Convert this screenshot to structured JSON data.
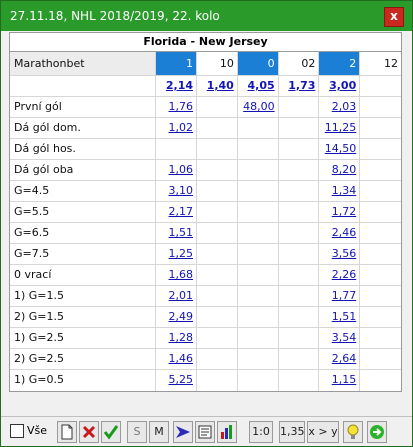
{
  "window": {
    "title": "27.11.18, NHL 2018/2019, 22. kolo",
    "close_label": "x"
  },
  "match": {
    "title": "Florida - New Jersey"
  },
  "table": {
    "bookmaker": "Marathonbet",
    "columns": [
      "1",
      "10",
      "0",
      "02",
      "2",
      "12"
    ],
    "main_odds": [
      "2,14",
      "1,40",
      "4,05",
      "1,73",
      "3,00",
      ""
    ],
    "rows": [
      {
        "label": "První gól",
        "values": [
          "1,76",
          "",
          "48,00",
          "",
          "2,03",
          ""
        ]
      },
      {
        "label": "Dá gól dom.",
        "values": [
          "1,02",
          "",
          "",
          "",
          "11,25",
          ""
        ]
      },
      {
        "label": "Dá gól hos.",
        "values": [
          "",
          "",
          "",
          "",
          "14,50",
          ""
        ]
      },
      {
        "label": "Dá gól oba",
        "values": [
          "1,06",
          "",
          "",
          "",
          "8,20",
          ""
        ]
      },
      {
        "label": "G=4.5",
        "values": [
          "3,10",
          "",
          "",
          "",
          "1,34",
          ""
        ]
      },
      {
        "label": "G=5.5",
        "values": [
          "2,17",
          "",
          "",
          "",
          "1,72",
          ""
        ]
      },
      {
        "label": "G=6.5",
        "values": [
          "1,51",
          "",
          "",
          "",
          "2,46",
          ""
        ]
      },
      {
        "label": "G=7.5",
        "values": [
          "1,25",
          "",
          "",
          "",
          "3,56",
          ""
        ]
      },
      {
        "label": "0 vrací",
        "values": [
          "1,68",
          "",
          "",
          "",
          "2,26",
          ""
        ]
      },
      {
        "label": "1) G=1.5",
        "values": [
          "2,01",
          "",
          "",
          "",
          "1,77",
          ""
        ]
      },
      {
        "label": "2) G=1.5",
        "values": [
          "2,49",
          "",
          "",
          "",
          "1,51",
          ""
        ]
      },
      {
        "label": "1) G=2.5",
        "values": [
          "1,28",
          "",
          "",
          "",
          "3,54",
          ""
        ]
      },
      {
        "label": "2) G=2.5",
        "values": [
          "1,46",
          "",
          "",
          "",
          "2,64",
          ""
        ]
      },
      {
        "label": "1) G=0.5",
        "values": [
          "5,25",
          "",
          "",
          "",
          "1,15",
          ""
        ]
      }
    ]
  },
  "toolbar": {
    "all_label": "Vše",
    "s_label": "S",
    "m_label": "M",
    "score_label": "1:0",
    "odds_label": "1,35",
    "compare_label": "x > y"
  },
  "colors": {
    "titlebar": "#2a9a2a",
    "header_blue": "#1c7fd6",
    "link": "#1414b4"
  }
}
